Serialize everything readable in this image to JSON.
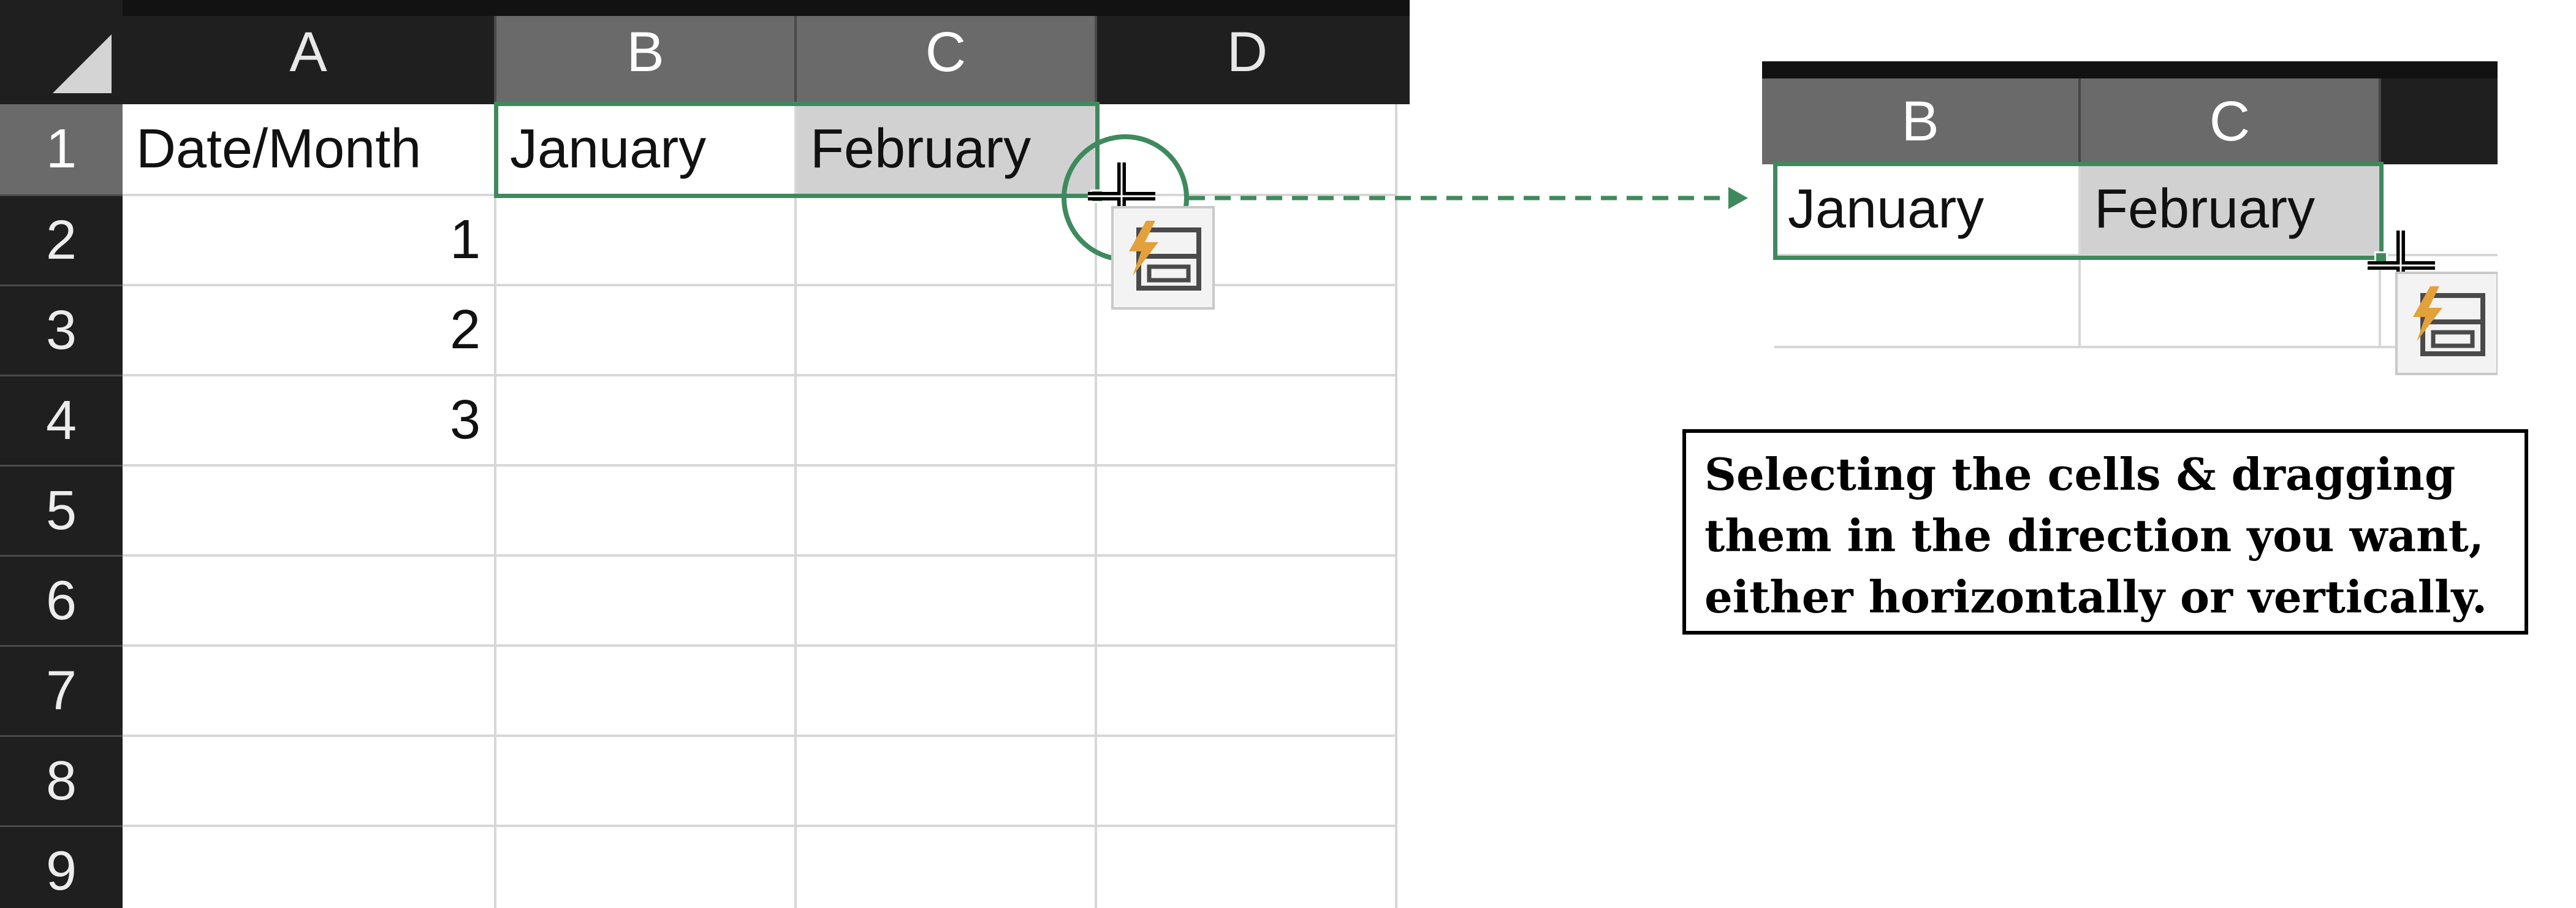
{
  "spreadsheet": {
    "column_headers": [
      "A",
      "B",
      "C",
      "D"
    ],
    "row_headers": [
      "1",
      "2",
      "3",
      "4",
      "5",
      "6",
      "7",
      "8",
      "9"
    ],
    "cells": {
      "A1": "Date/Month",
      "B1": "January",
      "C1": "February",
      "A2": "1",
      "A3": "2",
      "A4": "3"
    },
    "selection": "B1:C1"
  },
  "zoom_view": {
    "column_headers": [
      "B",
      "C"
    ],
    "cells": {
      "B1": "January",
      "C1": "February"
    }
  },
  "caption": {
    "lines": [
      "Selecting the cells & dragging",
      "them in the direction you want,",
      "either horizontally or vertically."
    ]
  },
  "icons": {
    "fill_cursor": "crosshair-plus-icon",
    "auto_fill_options": "flash-fill-icon",
    "select_all": "select-all-triangle-icon"
  },
  "colors": {
    "selection_border": "#3f8a5d",
    "header_bg": "#1f1f1f",
    "selected_header_bg": "#6a6a6a",
    "highlight_cell": "#d1d1d1",
    "flash_icon": "#e2a13a"
  }
}
